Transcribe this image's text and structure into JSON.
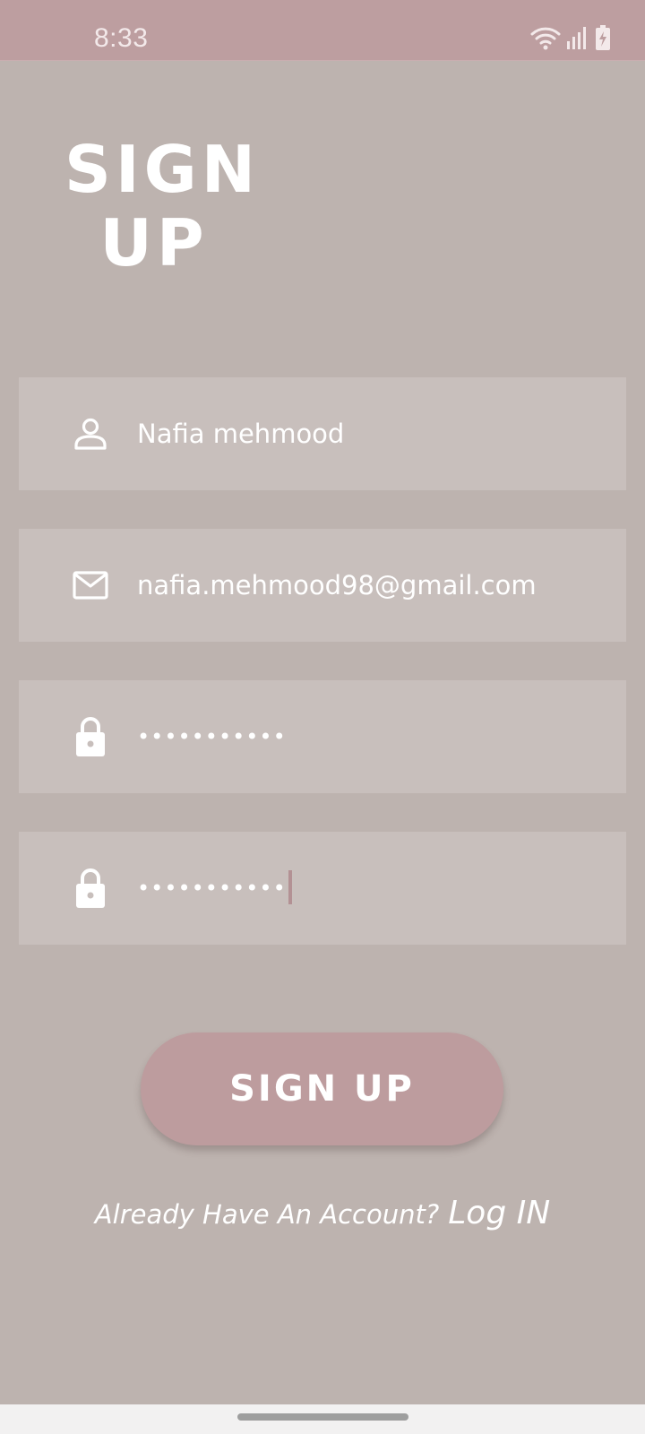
{
  "status_bar": {
    "time": "8:33",
    "icons": [
      "wifi-icon",
      "cell-signal-icon",
      "battery-charging-icon"
    ]
  },
  "header": {
    "title_line1": "SIGN",
    "title_line2": "UP"
  },
  "form": {
    "name_value": "Nafia mehmood",
    "email_value": "nafia.mehmood98@gmail.com",
    "password_value": "•••••••••••",
    "confirm_password_value": "•••••••••••",
    "icons": {
      "name": "person-icon",
      "email": "mail-icon",
      "password": "lock-icon",
      "confirm_password": "lock-icon"
    }
  },
  "actions": {
    "signup_label": "SIGN UP",
    "login_prompt": "Already Have An Account?",
    "login_link": "Log IN"
  },
  "colors": {
    "background": "#bdb3af",
    "status_bar": "#bd9ea0",
    "field": "#c8bfbc",
    "button": "#bd9c9e",
    "text": "#ffffff"
  }
}
